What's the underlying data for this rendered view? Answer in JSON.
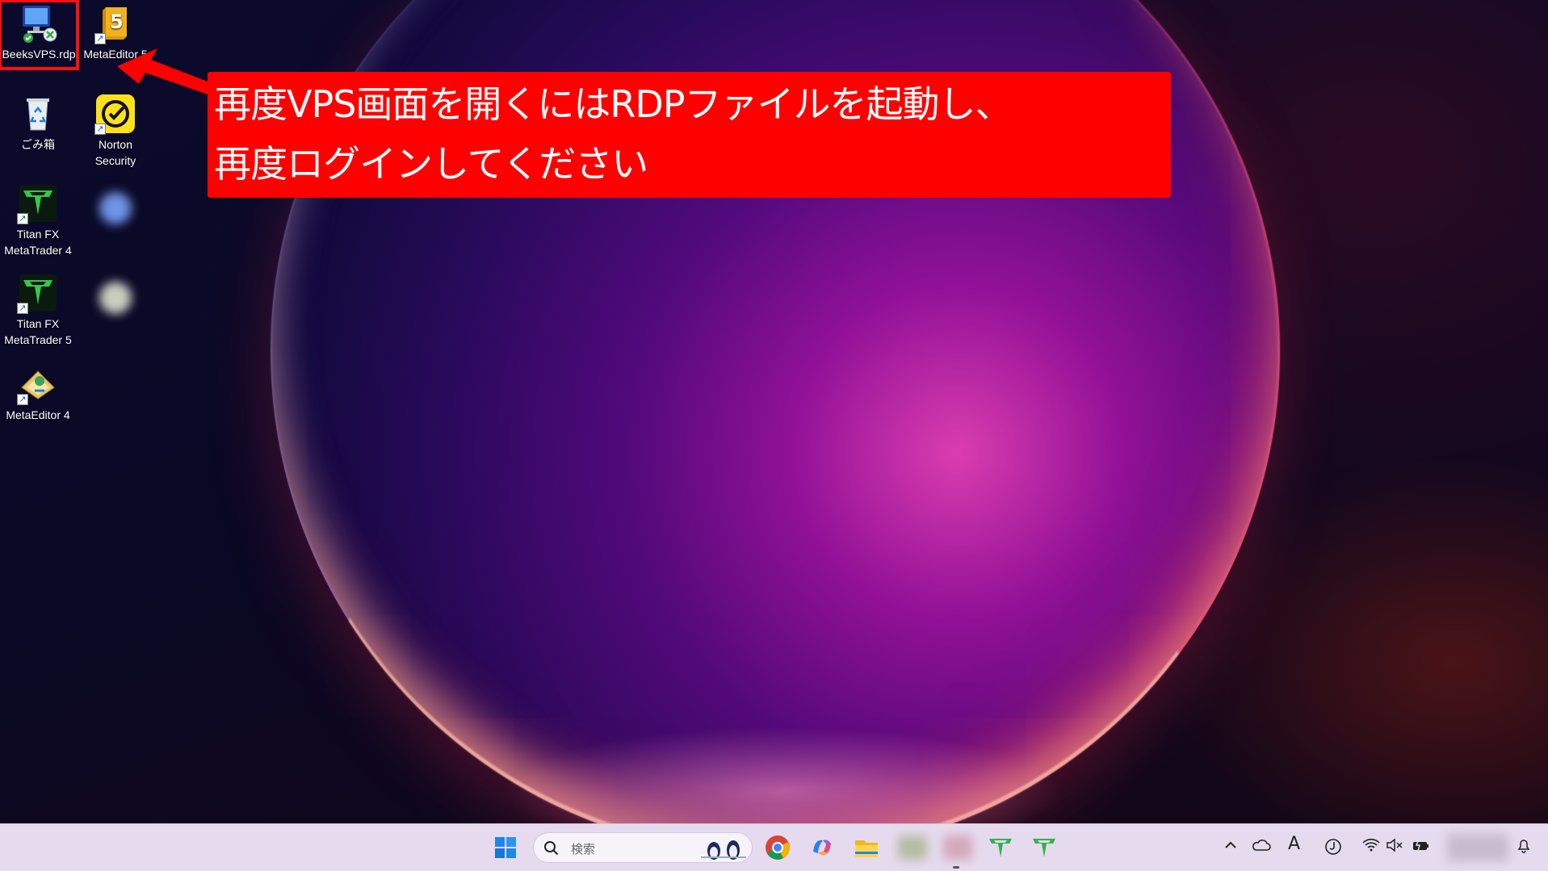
{
  "desktop": {
    "icons": [
      {
        "label": "BeeksVPS.rdp"
      },
      {
        "label": "MetaEditor 5"
      },
      {
        "label": "ごみ箱"
      },
      {
        "label": "Norton Security"
      },
      {
        "label": "Titan FX MetaTrader 4"
      },
      {
        "label": "Titan FX MetaTrader 5"
      },
      {
        "label": "MetaEditor 4"
      }
    ]
  },
  "callout": {
    "line1": "再度VPS画面を開くにはRDPファイルを起動し、",
    "line2": "再度ログインしてください",
    "color": "#ff0000"
  },
  "taskbar": {
    "search_placeholder": "検索",
    "apps": [
      "start-icon",
      "chrome-icon",
      "copilot-icon",
      "file-explorer-icon",
      "titanfx-mt4-icon",
      "titanfx-mt5-icon"
    ],
    "tray_font_indicator": "A"
  },
  "colors": {
    "highlight": "#ff1010",
    "taskbar_bg": "#e6dbee"
  }
}
